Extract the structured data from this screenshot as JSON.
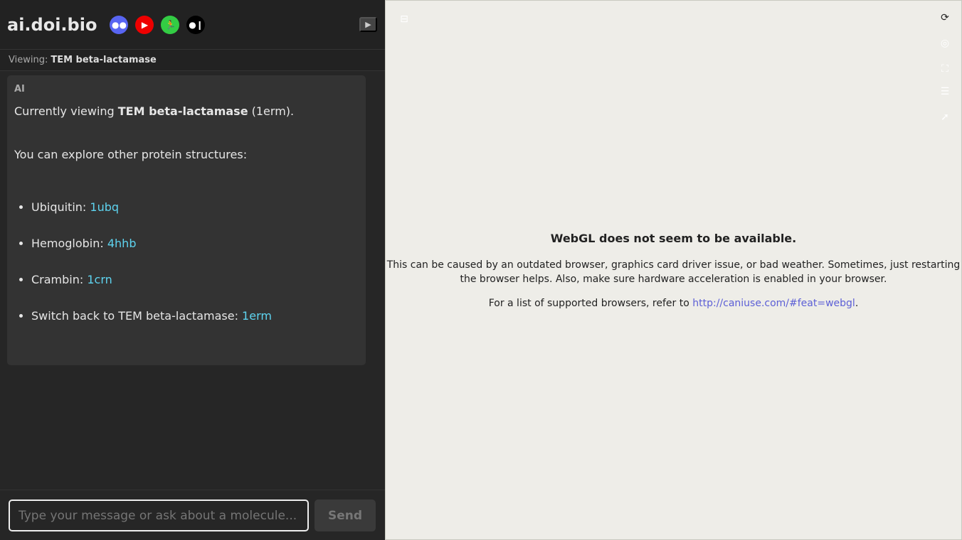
{
  "header": {
    "title": "ai.doi.bio",
    "socials": [
      "discord-icon",
      "youtube-icon",
      "runner-icon",
      "medium-icon"
    ],
    "toggle": "▶"
  },
  "viewing": {
    "label": "Viewing:",
    "name": "TEM beta-lactamase"
  },
  "message": {
    "sender": "AI",
    "line1_prefix": "Currently viewing ",
    "line1_bold": "TEM beta-lactamase",
    "line1_suffix": " (1erm).",
    "line2": "You can explore other protein structures:",
    "items": [
      {
        "label": "Ubiquitin: ",
        "link": "1ubq"
      },
      {
        "label": "Hemoglobin: ",
        "link": "4hhb"
      },
      {
        "label": "Crambin: ",
        "link": "1crn"
      },
      {
        "label": "Switch back to TEM beta-lactamase: ",
        "link": "1erm"
      }
    ]
  },
  "input": {
    "placeholder": "Type your message or ask about a molecule...",
    "send": "Send"
  },
  "viewer": {
    "title": "WebGL does not seem to be available.",
    "line1": "This can be caused by an outdated browser, graphics card driver issue, or bad weather. Sometimes, just restarting the browser helps. Also, make sure hardware acceleration is enabled in your browser.",
    "line2_prefix": "For a list of supported browsers, refer to ",
    "link": "http://caniuse.com/#feat=webgl",
    "line2_suffix": "."
  }
}
